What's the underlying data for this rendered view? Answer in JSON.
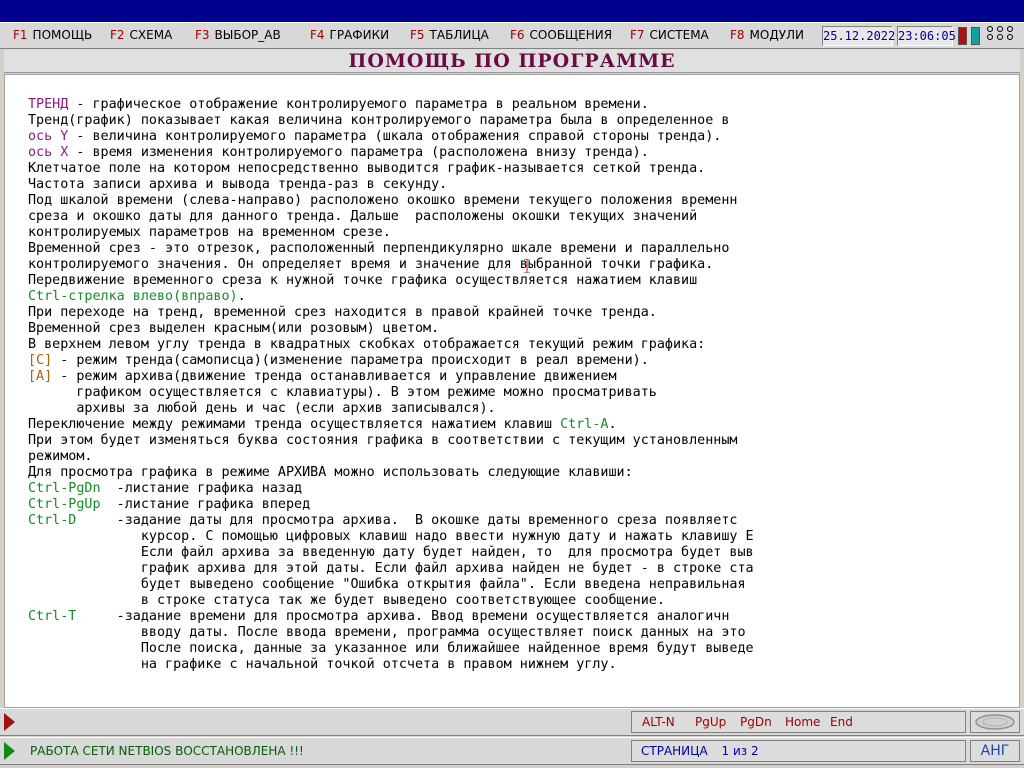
{
  "menu": [
    {
      "key": "F1",
      "label": "ПОМОЩЬ"
    },
    {
      "key": "F2",
      "label": "СХЕМА"
    },
    {
      "key": "F3",
      "label": "ВЫБОР_АВ"
    },
    {
      "key": "F4",
      "label": "ГРАФИКИ"
    },
    {
      "key": "F5",
      "label": "ТАБЛИЦА"
    },
    {
      "key": "F6",
      "label": "СООБЩЕНИЯ"
    },
    {
      "key": "F7",
      "label": "СИСТЕМА"
    },
    {
      "key": "F8",
      "label": "МОДУЛИ"
    }
  ],
  "system": {
    "date": "25.12.2022",
    "time": "23:06:05"
  },
  "colors": {
    "indicator_red": "#b01010",
    "indicator_teal": "#10a0a0",
    "title_bar": "#00008c"
  },
  "page_title": "ПОМОЩЬ ПО ПРОГРАММЕ",
  "doc_lines": [
    [
      {
        "t": "ТРЕНД",
        "c": "term"
      },
      {
        "t": " - графическое отображение контролируемого параметра в реальном времени."
      }
    ],
    [
      {
        "t": "Тренд(график) показывает какая величина контролируемого параметра была в определенное в"
      }
    ],
    [
      {
        "t": "ось Y",
        "c": "term"
      },
      {
        "t": " - величина контролируемого параметра (шкала отображения справой стороны тренда)."
      }
    ],
    [
      {
        "t": "ось X",
        "c": "term"
      },
      {
        "t": " - время изменения контролируемого параметра (расположена внизу тренда)."
      }
    ],
    [
      {
        "t": "Клетчатое поле на котором непосредственно выводится график-называется сеткой тренда."
      }
    ],
    [
      {
        "t": "Частота записи архива и вывода тренда-раз в секунду."
      }
    ],
    [
      {
        "t": "Под шкалой времени (слева-направо) расположено окошко времени текущего положения временн"
      }
    ],
    [
      {
        "t": "среза и окошко даты для данного тренда. Дальше  расположены окошки текущих значений"
      }
    ],
    [
      {
        "t": "контролируемых параметров на временном срезе."
      }
    ],
    [
      {
        "t": "Временной срез - это отрезок, расположенный перпендикулярно шкале времени и параллельно"
      }
    ],
    [
      {
        "t": "контролируемого значения. Он определяет время и значение для выбранной точки графика."
      }
    ],
    [
      {
        "t": "Передвижение временного среза к нужной точке графика осуществляется нажатием клавиш"
      }
    ],
    [
      {
        "t": "Ctrl-стрелка влево(вправо)",
        "c": "key"
      },
      {
        "t": "."
      }
    ],
    [
      {
        "t": "При переходе на тренд, временной срез находится в правой крайней точке тренда."
      }
    ],
    [
      {
        "t": "Временной срез выделен красным(или розовым) цветом."
      }
    ],
    [
      {
        "t": "В верхнем левом углу тренда в квадратных скобках отображается текущий режим графика:"
      }
    ],
    [
      {
        "t": "[C]",
        "c": "mode"
      },
      {
        "t": " - режим тренда(самописца)(изменение параметра происходит в реал времени)."
      }
    ],
    [
      {
        "t": "[A]",
        "c": "mode"
      },
      {
        "t": " - режим архива(движение тренда останавливается и управление движением"
      }
    ],
    [
      {
        "t": "      графиком осуществляется с клавиатуры). В этом режиме можно просматривать"
      }
    ],
    [
      {
        "t": "      архивы за любой день и час (если архив записывался)."
      }
    ],
    [
      {
        "t": "Переключение между режимами тренда осуществляется нажатием клавиш "
      },
      {
        "t": "Ctrl-A",
        "c": "key"
      },
      {
        "t": "."
      }
    ],
    [
      {
        "t": "При этом будет изменяться буква состояния графика в соответствии с текущим установленным"
      }
    ],
    [
      {
        "t": "режимом."
      }
    ],
    [
      {
        "t": "Для просмотра графика в режиме АРХИВА можно использовать следующие клавиши:"
      }
    ],
    [
      {
        "t": "Ctrl-PgDn",
        "c": "key"
      },
      {
        "t": "  -листание графика назад"
      }
    ],
    [
      {
        "t": "Ctrl-PgUp",
        "c": "key"
      },
      {
        "t": "  -листание графика вперед"
      }
    ],
    [
      {
        "t": "Ctrl-D",
        "c": "key"
      },
      {
        "t": "     -задание даты для просмотра архива.  В окошке даты временного среза появляетс"
      }
    ],
    [
      {
        "t": "              курсор. С помощью цифровых клавиш надо ввести нужную дату и нажать клавишу E"
      }
    ],
    [
      {
        "t": "              Если файл архива за введенную дату будет найден, то  для просмотра будет выв"
      }
    ],
    [
      {
        "t": "              график архива для этой даты. Если файл архива найден не будет - в строке ста"
      }
    ],
    [
      {
        "t": "              будет выведено сообщение \"Ошибка открытия файла\". Если введена неправильная"
      }
    ],
    [
      {
        "t": "              в строке статуса так же будет выведено соответствующее сообщение."
      }
    ],
    [
      {
        "t": "Ctrl-T",
        "c": "key"
      },
      {
        "t": "     -задание времени для просмотра архива. Ввод времени осуществляется аналогичн"
      }
    ],
    [
      {
        "t": "              вводу даты. После ввода времени, программа осуществляет поиск данных на это"
      }
    ],
    [
      {
        "t": "              После поиска, данные за указанное или ближайшее найденное время будут выведе"
      }
    ],
    [
      {
        "t": "              на графике с начальной точкой отсчета в правом нижнем углу."
      }
    ]
  ],
  "status": {
    "message": "РАБОТА СЕТИ NETBIOS ВОССТАНОВЛЕНА !!!",
    "keys": [
      "ALT-N",
      "PgUp",
      "PgDn",
      "Home",
      "End"
    ],
    "page_label": "СТРАНИЦА",
    "page_value": "1 из 2",
    "language": "АНГ"
  }
}
